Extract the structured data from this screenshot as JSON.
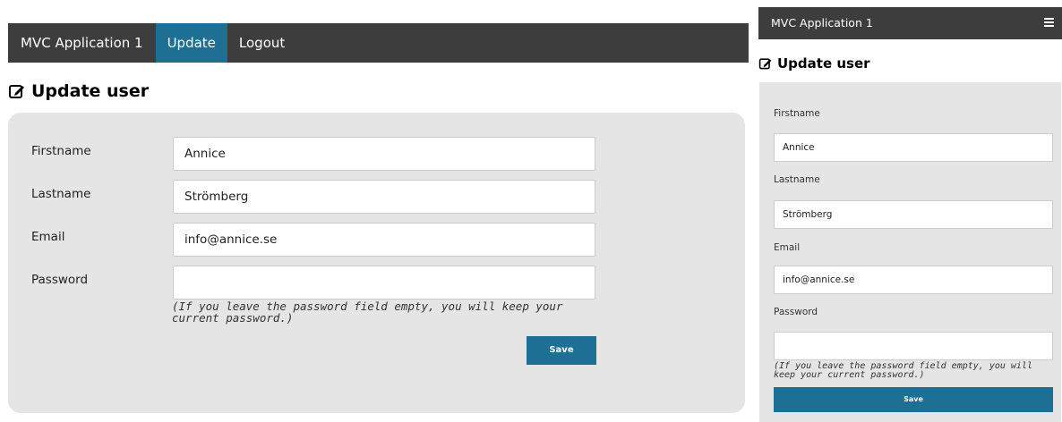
{
  "desktop": {
    "nav": {
      "brand": "MVC Application 1",
      "items": [
        {
          "label": "Update",
          "active": true
        },
        {
          "label": "Logout",
          "active": false
        }
      ]
    },
    "heading": "Update user",
    "form": {
      "firstname_label": "Firstname",
      "firstname_value": "Annice",
      "lastname_label": "Lastname",
      "lastname_value": "Strömberg",
      "email_label": "Email",
      "email_value": "info@annice.se",
      "password_label": "Password",
      "password_value": "",
      "password_hint": "(If you leave the password field empty, you will keep your current password.)",
      "save_label": "Save"
    }
  },
  "mobile": {
    "brand": "MVC Application 1",
    "menu_icon": "hamburger-menu-icon",
    "heading": "Update user",
    "form": {
      "firstname_label": "Firstname",
      "firstname_value": "Annice",
      "lastname_label": "Lastname",
      "lastname_value": "Strömberg",
      "email_label": "Email",
      "email_value": "info@annice.se",
      "password_label": "Password",
      "password_value": "",
      "password_hint": "(If you leave the password field empty, you will keep your current password.)",
      "save_label": "Save"
    }
  },
  "colors": {
    "navbar": "#3d3d3d",
    "accent": "#1d6f94",
    "panel": "#e5e5e5"
  }
}
